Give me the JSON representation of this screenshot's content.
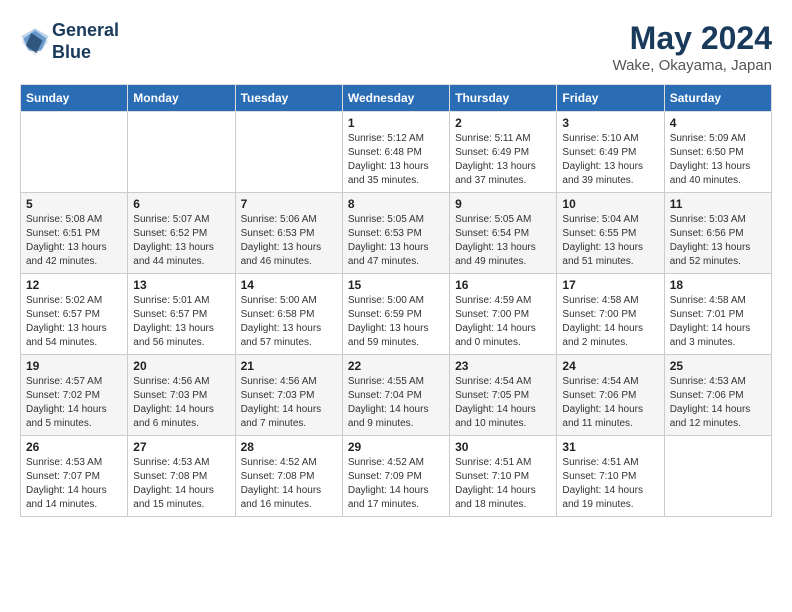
{
  "header": {
    "logo_line1": "General",
    "logo_line2": "Blue",
    "month": "May 2024",
    "location": "Wake, Okayama, Japan"
  },
  "weekdays": [
    "Sunday",
    "Monday",
    "Tuesday",
    "Wednesday",
    "Thursday",
    "Friday",
    "Saturday"
  ],
  "weeks": [
    [
      {
        "day": "",
        "info": ""
      },
      {
        "day": "",
        "info": ""
      },
      {
        "day": "",
        "info": ""
      },
      {
        "day": "1",
        "info": "Sunrise: 5:12 AM\nSunset: 6:48 PM\nDaylight: 13 hours\nand 35 minutes."
      },
      {
        "day": "2",
        "info": "Sunrise: 5:11 AM\nSunset: 6:49 PM\nDaylight: 13 hours\nand 37 minutes."
      },
      {
        "day": "3",
        "info": "Sunrise: 5:10 AM\nSunset: 6:49 PM\nDaylight: 13 hours\nand 39 minutes."
      },
      {
        "day": "4",
        "info": "Sunrise: 5:09 AM\nSunset: 6:50 PM\nDaylight: 13 hours\nand 40 minutes."
      }
    ],
    [
      {
        "day": "5",
        "info": "Sunrise: 5:08 AM\nSunset: 6:51 PM\nDaylight: 13 hours\nand 42 minutes."
      },
      {
        "day": "6",
        "info": "Sunrise: 5:07 AM\nSunset: 6:52 PM\nDaylight: 13 hours\nand 44 minutes."
      },
      {
        "day": "7",
        "info": "Sunrise: 5:06 AM\nSunset: 6:53 PM\nDaylight: 13 hours\nand 46 minutes."
      },
      {
        "day": "8",
        "info": "Sunrise: 5:05 AM\nSunset: 6:53 PM\nDaylight: 13 hours\nand 47 minutes."
      },
      {
        "day": "9",
        "info": "Sunrise: 5:05 AM\nSunset: 6:54 PM\nDaylight: 13 hours\nand 49 minutes."
      },
      {
        "day": "10",
        "info": "Sunrise: 5:04 AM\nSunset: 6:55 PM\nDaylight: 13 hours\nand 51 minutes."
      },
      {
        "day": "11",
        "info": "Sunrise: 5:03 AM\nSunset: 6:56 PM\nDaylight: 13 hours\nand 52 minutes."
      }
    ],
    [
      {
        "day": "12",
        "info": "Sunrise: 5:02 AM\nSunset: 6:57 PM\nDaylight: 13 hours\nand 54 minutes."
      },
      {
        "day": "13",
        "info": "Sunrise: 5:01 AM\nSunset: 6:57 PM\nDaylight: 13 hours\nand 56 minutes."
      },
      {
        "day": "14",
        "info": "Sunrise: 5:00 AM\nSunset: 6:58 PM\nDaylight: 13 hours\nand 57 minutes."
      },
      {
        "day": "15",
        "info": "Sunrise: 5:00 AM\nSunset: 6:59 PM\nDaylight: 13 hours\nand 59 minutes."
      },
      {
        "day": "16",
        "info": "Sunrise: 4:59 AM\nSunset: 7:00 PM\nDaylight: 14 hours\nand 0 minutes."
      },
      {
        "day": "17",
        "info": "Sunrise: 4:58 AM\nSunset: 7:00 PM\nDaylight: 14 hours\nand 2 minutes."
      },
      {
        "day": "18",
        "info": "Sunrise: 4:58 AM\nSunset: 7:01 PM\nDaylight: 14 hours\nand 3 minutes."
      }
    ],
    [
      {
        "day": "19",
        "info": "Sunrise: 4:57 AM\nSunset: 7:02 PM\nDaylight: 14 hours\nand 5 minutes."
      },
      {
        "day": "20",
        "info": "Sunrise: 4:56 AM\nSunset: 7:03 PM\nDaylight: 14 hours\nand 6 minutes."
      },
      {
        "day": "21",
        "info": "Sunrise: 4:56 AM\nSunset: 7:03 PM\nDaylight: 14 hours\nand 7 minutes."
      },
      {
        "day": "22",
        "info": "Sunrise: 4:55 AM\nSunset: 7:04 PM\nDaylight: 14 hours\nand 9 minutes."
      },
      {
        "day": "23",
        "info": "Sunrise: 4:54 AM\nSunset: 7:05 PM\nDaylight: 14 hours\nand 10 minutes."
      },
      {
        "day": "24",
        "info": "Sunrise: 4:54 AM\nSunset: 7:06 PM\nDaylight: 14 hours\nand 11 minutes."
      },
      {
        "day": "25",
        "info": "Sunrise: 4:53 AM\nSunset: 7:06 PM\nDaylight: 14 hours\nand 12 minutes."
      }
    ],
    [
      {
        "day": "26",
        "info": "Sunrise: 4:53 AM\nSunset: 7:07 PM\nDaylight: 14 hours\nand 14 minutes."
      },
      {
        "day": "27",
        "info": "Sunrise: 4:53 AM\nSunset: 7:08 PM\nDaylight: 14 hours\nand 15 minutes."
      },
      {
        "day": "28",
        "info": "Sunrise: 4:52 AM\nSunset: 7:08 PM\nDaylight: 14 hours\nand 16 minutes."
      },
      {
        "day": "29",
        "info": "Sunrise: 4:52 AM\nSunset: 7:09 PM\nDaylight: 14 hours\nand 17 minutes."
      },
      {
        "day": "30",
        "info": "Sunrise: 4:51 AM\nSunset: 7:10 PM\nDaylight: 14 hours\nand 18 minutes."
      },
      {
        "day": "31",
        "info": "Sunrise: 4:51 AM\nSunset: 7:10 PM\nDaylight: 14 hours\nand 19 minutes."
      },
      {
        "day": "",
        "info": ""
      }
    ]
  ]
}
